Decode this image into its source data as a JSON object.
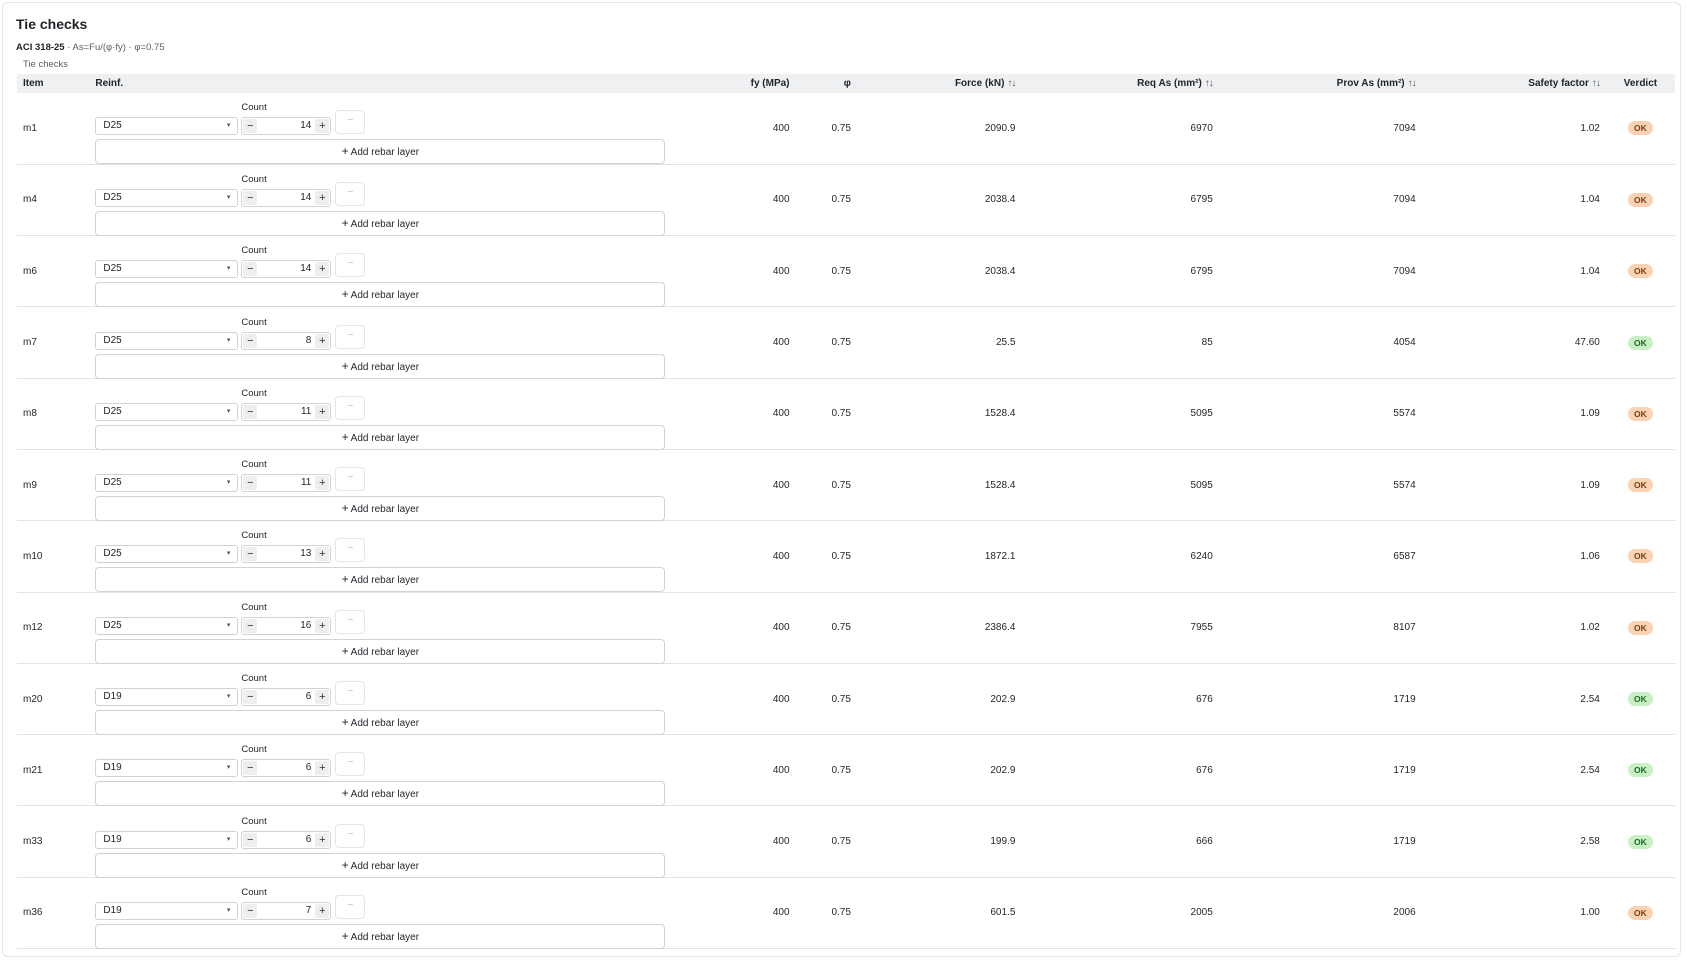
{
  "panel": {
    "title": "Tie checks",
    "code": "ACI 318-25",
    "formula": " · As=Fu/(φ·fy) · φ=0.75",
    "caption": "Tie checks"
  },
  "table": {
    "headers": {
      "item": "Item",
      "reinf": "Reinf.",
      "fy": "fy (MPa)",
      "phi": "φ",
      "force": "Force (kN)",
      "req_as": "Req As (mm²)",
      "prov_as": "Prov As (mm²)",
      "sf": "Safety factor",
      "verdict": "Verdict"
    },
    "sort_glyph": "↑↓",
    "count_label": "Count",
    "add_layer_label": "Add rebar layer",
    "add_layer_icon": "plus-icon",
    "remove_glyph": "−",
    "minus_glyph": "−",
    "plus_glyph": "+",
    "caret_glyph": "▾",
    "rows": [
      {
        "item": "m1",
        "bar": "D25",
        "count": "14",
        "fy": "400",
        "phi": "0.75",
        "force": "2090.9",
        "req_as": "6970",
        "prov_as": "7094",
        "sf": "1.02",
        "verdict": "OK",
        "status": "warn"
      },
      {
        "item": "m4",
        "bar": "D25",
        "count": "14",
        "fy": "400",
        "phi": "0.75",
        "force": "2038.4",
        "req_as": "6795",
        "prov_as": "7094",
        "sf": "1.04",
        "verdict": "OK",
        "status": "warn"
      },
      {
        "item": "m6",
        "bar": "D25",
        "count": "14",
        "fy": "400",
        "phi": "0.75",
        "force": "2038.4",
        "req_as": "6795",
        "prov_as": "7094",
        "sf": "1.04",
        "verdict": "OK",
        "status": "warn"
      },
      {
        "item": "m7",
        "bar": "D25",
        "count": "8",
        "fy": "400",
        "phi": "0.75",
        "force": "25.5",
        "req_as": "85",
        "prov_as": "4054",
        "sf": "47.60",
        "verdict": "OK",
        "status": "ok"
      },
      {
        "item": "m8",
        "bar": "D25",
        "count": "11",
        "fy": "400",
        "phi": "0.75",
        "force": "1528.4",
        "req_as": "5095",
        "prov_as": "5574",
        "sf": "1.09",
        "verdict": "OK",
        "status": "warn"
      },
      {
        "item": "m9",
        "bar": "D25",
        "count": "11",
        "fy": "400",
        "phi": "0.75",
        "force": "1528.4",
        "req_as": "5095",
        "prov_as": "5574",
        "sf": "1.09",
        "verdict": "OK",
        "status": "warn"
      },
      {
        "item": "m10",
        "bar": "D25",
        "count": "13",
        "fy": "400",
        "phi": "0.75",
        "force": "1872.1",
        "req_as": "6240",
        "prov_as": "6587",
        "sf": "1.06",
        "verdict": "OK",
        "status": "warn"
      },
      {
        "item": "m12",
        "bar": "D25",
        "count": "16",
        "fy": "400",
        "phi": "0.75",
        "force": "2386.4",
        "req_as": "7955",
        "prov_as": "8107",
        "sf": "1.02",
        "verdict": "OK",
        "status": "warn"
      },
      {
        "item": "m20",
        "bar": "D19",
        "count": "6",
        "fy": "400",
        "phi": "0.75",
        "force": "202.9",
        "req_as": "676",
        "prov_as": "1719",
        "sf": "2.54",
        "verdict": "OK",
        "status": "ok"
      },
      {
        "item": "m21",
        "bar": "D19",
        "count": "6",
        "fy": "400",
        "phi": "0.75",
        "force": "202.9",
        "req_as": "676",
        "prov_as": "1719",
        "sf": "2.54",
        "verdict": "OK",
        "status": "ok"
      },
      {
        "item": "m33",
        "bar": "D19",
        "count": "6",
        "fy": "400",
        "phi": "0.75",
        "force": "199.9",
        "req_as": "666",
        "prov_as": "1719",
        "sf": "2.58",
        "verdict": "OK",
        "status": "ok"
      },
      {
        "item": "m36",
        "bar": "D19",
        "count": "7",
        "fy": "400",
        "phi": "0.75",
        "force": "601.5",
        "req_as": "2005",
        "prov_as": "2006",
        "sf": "1.00",
        "verdict": "OK",
        "status": "warn"
      }
    ]
  },
  "colors": {
    "ok_badge": "#c8f0c4",
    "warn_badge": "#fbd3b4",
    "header_bg": "#eef0f2"
  }
}
